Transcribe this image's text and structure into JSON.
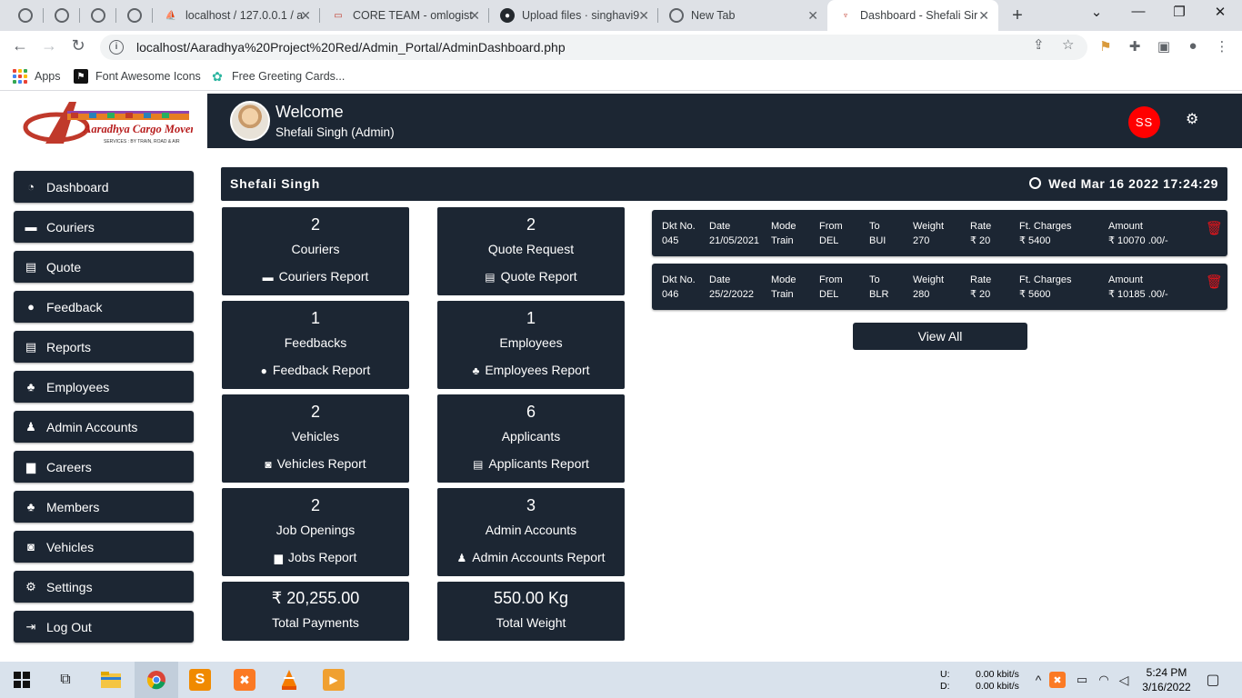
{
  "browser": {
    "tabs": [
      {
        "title": "",
        "active": false
      },
      {
        "title": "",
        "active": false
      },
      {
        "title": "",
        "active": false
      },
      {
        "title": "",
        "active": false
      },
      {
        "title": "localhost / 127.0.0.1 / a",
        "active": false
      },
      {
        "title": "CORE TEAM - omlogist",
        "active": false
      },
      {
        "title": "Upload files · singhavi9",
        "active": false
      },
      {
        "title": "New Tab",
        "active": false
      },
      {
        "title": "Dashboard - Shefali Sir",
        "active": true
      }
    ],
    "url": "localhost/Aaradhya%20Project%20Red/Admin_Portal/AdminDashboard.php",
    "bookmarks": [
      "Apps",
      "Font Awesome Icons",
      "Free Greeting Cards..."
    ]
  },
  "header": {
    "logo_text": "Aaradhya Cargo Movers",
    "logo_tagline": "SERVICES : BY TRAIN, ROAD & AIR",
    "welcome": "Welcome",
    "user": "Shefali Singh (Admin)",
    "initials": "SS"
  },
  "sidebar": {
    "items": [
      {
        "label": "Dashboard",
        "icon": "dashboard-icon"
      },
      {
        "label": "Couriers",
        "icon": "archive-icon"
      },
      {
        "label": "Quote",
        "icon": "file-icon"
      },
      {
        "label": "Feedback",
        "icon": "comments-icon"
      },
      {
        "label": "Reports",
        "icon": "file-icon"
      },
      {
        "label": "Employees",
        "icon": "users-icon"
      },
      {
        "label": "Admin Accounts",
        "icon": "user-plus-icon"
      },
      {
        "label": "Careers",
        "icon": "briefcase-icon"
      },
      {
        "label": "Members",
        "icon": "users-icon"
      },
      {
        "label": "Vehicles",
        "icon": "car-icon"
      },
      {
        "label": "Settings",
        "icon": "cogs-icon"
      },
      {
        "label": "Log Out",
        "icon": "sign-out-icon"
      }
    ]
  },
  "titlebar": {
    "name": "Shefali Singh",
    "datetime": "Wed Mar 16 2022 17:24:29"
  },
  "cards": [
    {
      "count": "2",
      "label": "Couriers",
      "report": "Couriers Report"
    },
    {
      "count": "2",
      "label": "Quote Request",
      "report": "Quote Report"
    },
    {
      "count": "1",
      "label": "Feedbacks",
      "report": "Feedback Report"
    },
    {
      "count": "1",
      "label": "Employees",
      "report": "Employees Report"
    },
    {
      "count": "2",
      "label": "Vehicles",
      "report": "Vehicles Report"
    },
    {
      "count": "6",
      "label": "Applicants",
      "report": "Applicants Report"
    },
    {
      "count": "2",
      "label": "Job Openings",
      "report": "Jobs Report"
    },
    {
      "count": "3",
      "label": "Admin Accounts",
      "report": "Admin Accounts Report"
    }
  ],
  "totals": [
    {
      "value": "₹ 20,255.00",
      "label": "Total Payments"
    },
    {
      "value": "550.00 Kg",
      "label": "Total Weight"
    }
  ],
  "dockets": {
    "headers": [
      "Dkt No.",
      "Date",
      "Mode",
      "From",
      "To",
      "Weight",
      "Rate",
      "Ft. Charges",
      "Amount"
    ],
    "rows": [
      [
        "045",
        "21/05/2021",
        "Train",
        "DEL",
        "BUI",
        "270",
        "₹ 20",
        "₹ 5400",
        "₹ 10070 .00/-"
      ],
      [
        "046",
        "25/2/2022",
        "Train",
        "DEL",
        "BLR",
        "280",
        "₹ 20",
        "₹ 5600",
        "₹ 10185 .00/-"
      ]
    ],
    "view_all": "View All"
  },
  "taskbar": {
    "net_up_label": "U:",
    "net_down_label": "D:",
    "net_up": "0.00 kbit/s",
    "net_down": "0.00 kbit/s",
    "time": "5:24 PM",
    "date": "3/16/2022"
  },
  "colors": {
    "panel": "#1c2633",
    "badge": "#ff0000",
    "trash": "#e8141a"
  }
}
